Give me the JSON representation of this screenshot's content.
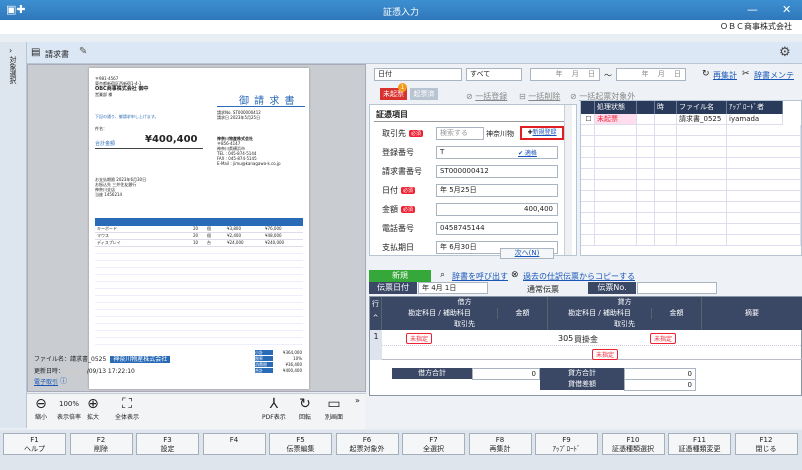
{
  "window": {
    "title": "証憑入力",
    "company": "ＯＢＣ商事株式会社"
  },
  "side": {
    "label": "対象選択"
  },
  "header": {
    "doc_type": "請求書"
  },
  "invoice": {
    "title": "御 請 求 書",
    "total_label": "合計金額",
    "total": "¥400,400",
    "sender": "OBC商事株式会社 御中",
    "issuer": "神奈川物産株式会社",
    "items": [
      {
        "name": "キーボード",
        "qty": "20",
        "unit": "個",
        "price": "¥3,800",
        "amount": "¥76,000"
      },
      {
        "name": "マウス",
        "qty": "20",
        "unit": "個",
        "price": "¥2,400",
        "amount": "¥48,000"
      },
      {
        "name": "ディスプレイ",
        "qty": "10",
        "unit": "台",
        "price": "¥24,000",
        "amount": "¥240,000"
      }
    ],
    "summary": [
      {
        "l": "小計",
        "v": "¥364,000"
      },
      {
        "l": "税率",
        "v": "10%"
      },
      {
        "l": "消費税",
        "v": "¥36,400"
      },
      {
        "l": "合計",
        "v": "¥400,400"
      }
    ]
  },
  "fileinfo": {
    "file_label": "ファイル名：",
    "file_value": "請求書_0525",
    "file_tag": "神奈川物産株式会社",
    "updated_label": "更新日時：",
    "updated_value": "/09/13 17:22:10",
    "account_link": "電子取引"
  },
  "zoom": {
    "shrink": "縮小",
    "percent": "100%",
    "percent_label": "表示倍率",
    "expand": "拡大",
    "full": "全体表示",
    "pdf": "PDF表示",
    "rotate": "回転",
    "window": "別画面"
  },
  "filter": {
    "date_mode": "日付",
    "status": "すべて",
    "from": "年 　月 　日",
    "tilde": "～",
    "to": "年 　月 　日",
    "reagg": "再集計",
    "settings": "辞書メンテ"
  },
  "tabs": {
    "unprocessed": "未起票",
    "badge": "1",
    "processed": "起票済",
    "bulk_register": "一括登録",
    "bulk_delete": "一括削除",
    "bulk_exclude": "一括起票対象外"
  },
  "form": {
    "section": "証憑項目",
    "fields": [
      {
        "label": "取引先",
        "req": "必須",
        "value": "検索する",
        "extra": "神奈川物",
        "link": "新規登録"
      },
      {
        "label": "登録番号",
        "value": "T",
        "link": "適格"
      },
      {
        "label": "請求書番号",
        "value": "ST000000412"
      },
      {
        "label": "日付",
        "req": "必須",
        "value": "年 5月25日"
      },
      {
        "label": "金額",
        "req": "必須",
        "value": "400,400"
      },
      {
        "label": "電話番号",
        "value": "0458745144"
      },
      {
        "label": "支払期日",
        "value": "年 6月30日"
      }
    ],
    "next": "次へ(N)"
  },
  "grid": {
    "headers": [
      "処理状態",
      "",
      "時",
      "ファイル名",
      "ｱｯﾌﾟﾛｰﾄﾞ者"
    ],
    "rows": [
      [
        "未起票",
        "",
        "",
        "請求書_0525",
        "iyamada"
      ]
    ]
  },
  "journal": {
    "new": "新規",
    "dict_link": "辞書を呼び出す",
    "copy_link": "過去の仕訳伝票からコピーする",
    "date_label": "伝票日付",
    "date_value": "年 4月 1日",
    "type": "通常伝票",
    "no_label": "伝票No.",
    "debit": "借方",
    "credit": "貸方",
    "debit_acct": "勘定科目 / 補助科目",
    "credit_acct": "勘定科目 / 補助科目",
    "amount": "金額",
    "partner": "取引先",
    "memo": "摘要",
    "row_header": "行",
    "row": {
      "num": "1",
      "debit_tag": "未指定",
      "credit_code": "305",
      "credit_name": "買掛金",
      "credit_tag": "未指定",
      "credit_partner_tag": "未指定"
    },
    "debit_total_label": "借方合計",
    "debit_total": "0",
    "credit_total_label": "貸方合計",
    "credit_total": "0",
    "diff_label": "貸借差額",
    "diff": "0"
  },
  "fkeys": [
    {
      "k": "F1",
      "l": "ヘルプ"
    },
    {
      "k": "F2",
      "l": "削除"
    },
    {
      "k": "F3",
      "l": "設定"
    },
    {
      "k": "F4",
      "l": ""
    },
    {
      "k": "F5",
      "l": "伝票編集"
    },
    {
      "k": "F6",
      "l": "起票対象外"
    },
    {
      "k": "F7",
      "l": "全選択"
    },
    {
      "k": "F8",
      "l": "再集計"
    },
    {
      "k": "F9",
      "l": "ｱｯﾌﾟﾛｰﾄﾞ"
    },
    {
      "k": "F10",
      "l": "証憑種類選択"
    },
    {
      "k": "F11",
      "l": "証憑種類変更"
    },
    {
      "k": "F12",
      "l": "閉じる"
    }
  ]
}
